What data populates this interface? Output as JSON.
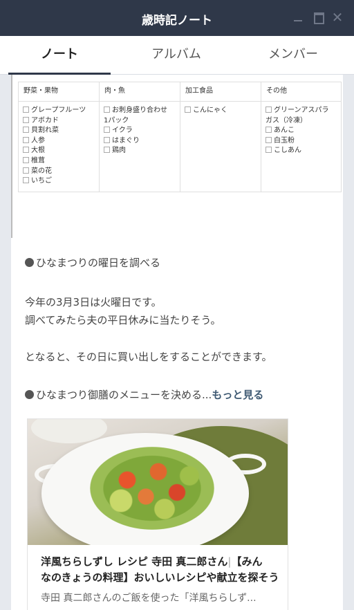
{
  "window": {
    "title": "歳時記ノート",
    "minimize": "minimize-icon",
    "maximize": "maximize-icon",
    "close": "close-icon"
  },
  "tabs": [
    {
      "label": "ノート",
      "active": true
    },
    {
      "label": "アルバム",
      "active": false
    },
    {
      "label": "メンバー",
      "active": false
    }
  ],
  "grocery": {
    "columns": [
      {
        "header": "野菜・果物",
        "items": [
          "グレープフルーツ",
          "アボカド",
          "貝割れ菜",
          "人参",
          "大根",
          "椎茸",
          "菜の花",
          "いちご"
        ]
      },
      {
        "header": "肉・魚",
        "items": [
          "お刺身盛り合わせ",
          "1パック",
          "イクラ",
          "はまぐり",
          "鶏肉"
        ]
      },
      {
        "header": "加工食品",
        "items": [
          "こんにゃく"
        ]
      },
      {
        "header": "その他",
        "items": [
          "グリーンアスパラ",
          "ガス（冷凍）",
          "あんこ",
          "白玉粉",
          "こしあん"
        ]
      }
    ]
  },
  "note": {
    "heading1": "ひなまつりの曜日を調べる",
    "line1": "今年の3月3日は火曜日です。",
    "line2": "調べてみたら夫の平日休みに当たりそう。",
    "line3": "となると、その日に買い出しをすることができます。",
    "heading2": "ひなまつり御膳のメニューを決める...",
    "more": "もっと見る"
  },
  "card": {
    "title_part1": "洋風ちらしずし レシピ 寺田 真二郎さん",
    "separator": "|",
    "title_part2": "【みん",
    "title_line2": "なのきょうの料理】おいしいレシピや献立を探そう",
    "description": "寺田 真二郎さんのご飯を使った「洋風ちらしず..."
  }
}
